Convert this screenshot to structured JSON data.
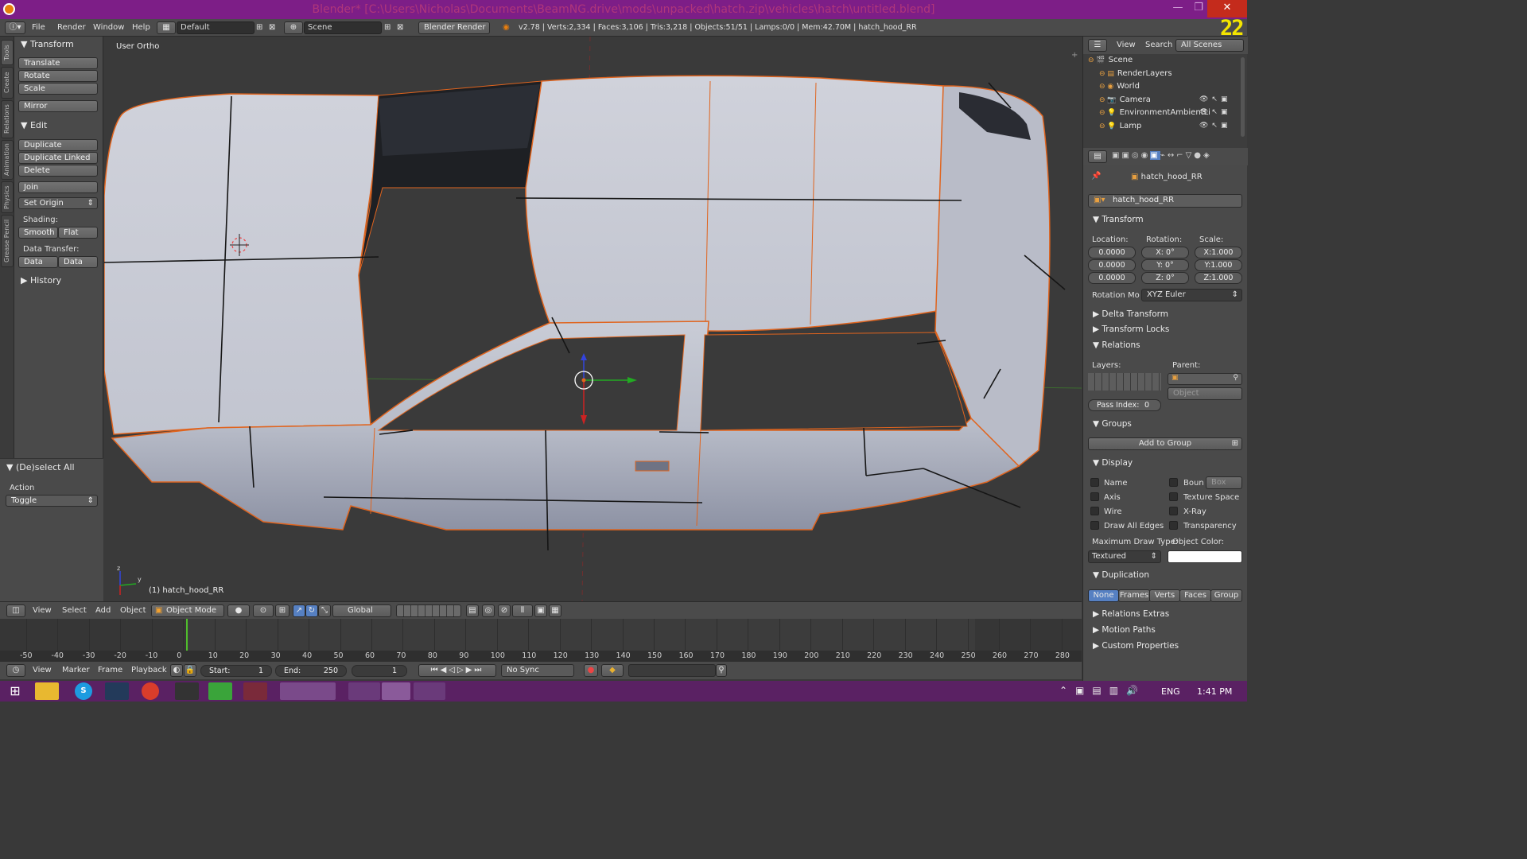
{
  "window": {
    "title": "Blender* [C:\\Users\\Nicholas\\Documents\\BeamNG.drive\\mods\\unpacked\\hatch.zip\\vehicles\\hatch\\untitled.blend]",
    "controls": [
      "—",
      "❐",
      "✕"
    ]
  },
  "menu": {
    "items": [
      "File",
      "Render",
      "Window",
      "Help"
    ],
    "layout": "Default",
    "scene": "Scene",
    "engine": "Blender Render",
    "stats": "v2.78 | Verts:2,334 | Faces:3,106 | Tris:3,218 | Objects:51/51 | Lamps:0/0 | Mem:42.70M | hatch_hood_RR"
  },
  "overlay_counter": "22",
  "lefttabs": [
    "Tools",
    "Create",
    "Relations",
    "Animation",
    "Physics",
    "Grease Pencil"
  ],
  "tools": {
    "transform_header": "Transform",
    "translate": "Translate",
    "rotate": "Rotate",
    "scale": "Scale",
    "mirror": "Mirror",
    "edit_header": "Edit",
    "duplicate": "Duplicate",
    "duplicate_linked": "Duplicate Linked",
    "delete": "Delete",
    "join": "Join",
    "set_origin": "Set Origin",
    "shading_label": "Shading:",
    "smooth": "Smooth",
    "flat": "Flat",
    "data_transfer_label": "Data Transfer:",
    "data": "Data",
    "data_layout": "Data Layo",
    "history_header": "History",
    "deselect_header": "(De)select All",
    "action_label": "Action",
    "action_value": "Toggle"
  },
  "viewport": {
    "view_label": "User Ortho",
    "object_label": "(1) hatch_hood_RR",
    "axis_y": "y",
    "axis_z": "z"
  },
  "view_header": {
    "menus": [
      "View",
      "Select",
      "Add",
      "Object"
    ],
    "mode": "Object Mode",
    "orientation": "Global"
  },
  "timeline": {
    "ticks": [
      "-50",
      "-40",
      "-30",
      "-20",
      "-10",
      "0",
      "10",
      "20",
      "30",
      "40",
      "50",
      "60",
      "70",
      "80",
      "90",
      "100",
      "110",
      "120",
      "130",
      "140",
      "150",
      "160",
      "170",
      "180",
      "190",
      "200",
      "210",
      "220",
      "230",
      "240",
      "250",
      "260",
      "270",
      "280"
    ]
  },
  "timeline_header": {
    "menus": [
      "View",
      "Marker",
      "Frame",
      "Playback"
    ],
    "start_label": "Start:",
    "start": "1",
    "end_label": "End:",
    "end": "250",
    "current": "1",
    "sync": "No Sync"
  },
  "outliner": {
    "view": "View",
    "search": "Search",
    "filter": "All Scenes",
    "items": [
      {
        "name": "Scene",
        "depth": 0
      },
      {
        "name": "RenderLayers",
        "depth": 1
      },
      {
        "name": "World",
        "depth": 1
      },
      {
        "name": "Camera",
        "depth": 1
      },
      {
        "name": "EnvironmentAmbientLi",
        "depth": 1
      },
      {
        "name": "Lamp",
        "depth": 1
      }
    ]
  },
  "properties": {
    "breadcrumb": "hatch_hood_RR",
    "object_name": "hatch_hood_RR",
    "transform_header": "Transform",
    "location_label": "Location:",
    "rotation_label": "Rotation:",
    "scale_label": "Scale:",
    "location": [
      "0.0000",
      "0.0000",
      "0.0000"
    ],
    "rotation": [
      {
        "axis": "X:",
        "value": "0°"
      },
      {
        "axis": "Y:",
        "value": "0°"
      },
      {
        "axis": "Z:",
        "value": "0°"
      }
    ],
    "scale": [
      "X:1.000",
      "Y:1.000",
      "Z:1.000"
    ],
    "rotation_mode_label": "Rotation Mo",
    "rotation_mode": "XYZ Euler",
    "delta_transform": "Delta Transform",
    "transform_locks": "Transform Locks",
    "relations_header": "Relations",
    "layers_label": "Layers:",
    "parent_label": "Parent:",
    "parent_type": "Object",
    "pass_index_label": "Pass Index:",
    "pass_index": "0",
    "groups_header": "Groups",
    "add_to_group": "Add to Group",
    "display_header": "Display",
    "name": "Name",
    "bounds": "Boun",
    "bounds_type": "Box",
    "axis": "Axis",
    "texture_space": "Texture Space",
    "wire": "Wire",
    "xray": "X-Ray",
    "draw_all_edges": "Draw All Edges",
    "transparency": "Transparency",
    "max_draw_label": "Maximum Draw Type:",
    "max_draw": "Textured",
    "object_color_label": "Object Color:",
    "duplication_header": "Duplication",
    "dup_tabs": [
      "None",
      "Frames",
      "Verts",
      "Faces",
      "Group"
    ],
    "relations_extras": "Relations Extras",
    "motion_paths": "Motion Paths",
    "custom_properties": "Custom Properties"
  },
  "taskbar": {
    "lang": "ENG",
    "time": "1:41 PM"
  },
  "colors": {
    "title_bg": "#7d1e87",
    "selection_outline": "#e0641e",
    "active_tab": "#5680c2",
    "taskbar": "#5a2163"
  }
}
